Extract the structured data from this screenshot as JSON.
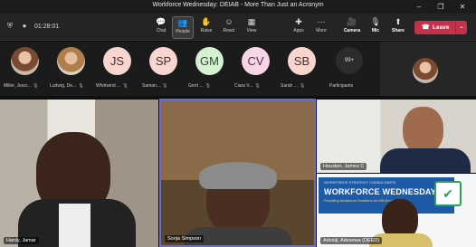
{
  "window": {
    "title": "Workforce Wednesday: DEIAB - More Than Just an Acronym",
    "controls": [
      "–",
      "❐",
      "✕"
    ]
  },
  "toolbar": {
    "timer": "01:28:01",
    "buttons": [
      {
        "label": "Chat",
        "icon": "chat-icon",
        "glyph": "💬"
      },
      {
        "label": "People",
        "icon": "people-icon",
        "glyph": "👥"
      },
      {
        "label": "Raise",
        "icon": "raise-hand-icon",
        "glyph": "✋"
      },
      {
        "label": "React",
        "icon": "react-icon",
        "glyph": "☺"
      },
      {
        "label": "View",
        "icon": "view-icon",
        "glyph": "▦"
      },
      {
        "label": "Apps",
        "icon": "apps-icon",
        "glyph": "✚"
      },
      {
        "label": "More",
        "icon": "more-icon",
        "glyph": "⋯"
      },
      {
        "label": "Camera",
        "icon": "camera-icon",
        "glyph": "🎥"
      },
      {
        "label": "Mic",
        "icon": "mic-off-icon",
        "glyph": "🎙"
      },
      {
        "label": "Share",
        "icon": "share-icon",
        "glyph": "⬆"
      }
    ],
    "leave": {
      "label": "Leave",
      "accent": "#c4314b"
    }
  },
  "gallery": {
    "people": [
      {
        "name": "Miller, Jessi...",
        "initials": "",
        "color": "",
        "photo": true
      },
      {
        "name": "Ludwig, De...",
        "initials": "",
        "color": "",
        "photo": true
      },
      {
        "name": "Whirlwind ...",
        "initials": "JS",
        "color": "#f8d6cf"
      },
      {
        "name": "Saman...",
        "initials": "SP",
        "color": "#f8d6cf"
      },
      {
        "name": "Gerri ...",
        "initials": "GM",
        "color": "#d6f0d2"
      },
      {
        "name": "Ciara V...",
        "initials": "CV",
        "color": "#f7d4e6"
      },
      {
        "name": "Sarah ...",
        "initials": "SB",
        "color": "#f8d6cf"
      }
    ],
    "overflow": {
      "count": "99+",
      "label": "Participants"
    }
  },
  "videos": [
    {
      "name": "Hardy, Jamar"
    },
    {
      "name": "Sonja Simpson"
    },
    {
      "name": "Houston, James C"
    },
    {
      "name": "Adesiji, Adesewa (DEED)"
    }
  ],
  "slide": {
    "small": "WORKFORCE STRATEGY CONSULTANTS",
    "title": "WORKFORCE WEDNESDAY",
    "subtitle": "Providing Workforce Solutions for MN Employers"
  }
}
